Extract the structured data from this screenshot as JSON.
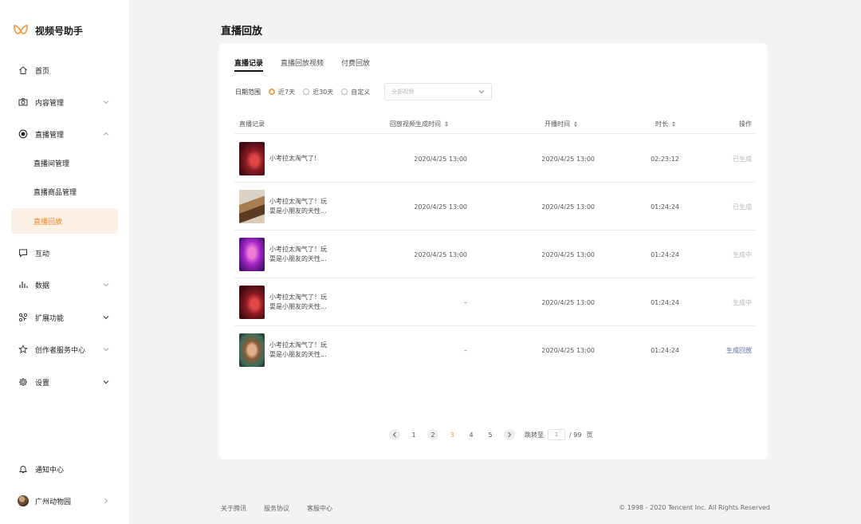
{
  "brand": {
    "name": "视频号助手",
    "accent": "#e8852a"
  },
  "sidebar": {
    "items": [
      {
        "label": "首页",
        "icon": "home-icon"
      },
      {
        "label": "内容管理",
        "icon": "camera-icon"
      },
      {
        "label": "直播管理",
        "icon": "live-icon"
      },
      {
        "label": "直播间管理"
      },
      {
        "label": "直播商品管理"
      },
      {
        "label": "直播回放",
        "active": true
      },
      {
        "label": "互动",
        "icon": "message-icon"
      },
      {
        "label": "数据",
        "icon": "bar-chart-icon"
      },
      {
        "label": "扩展功能",
        "icon": "extension-icon"
      },
      {
        "label": "创作者服务中心",
        "icon": "star-icon"
      },
      {
        "label": "设置",
        "icon": "gear-icon"
      }
    ],
    "notify": {
      "label": "通知中心",
      "icon": "bell-icon"
    },
    "account": {
      "label": "广州动物园",
      "icon": "avatar"
    }
  },
  "page": {
    "title": "直播回放"
  },
  "tabs": [
    "直播记录",
    "直播回放视频",
    "付费回放"
  ],
  "filters": {
    "label": "日期范围",
    "options": [
      "近7天",
      "近30天",
      "自定义"
    ],
    "selected": "近7天",
    "select_placeholder": "全部视频"
  },
  "table": {
    "headers": {
      "record": "直播记录",
      "gen_time": "回放视频生成时间",
      "start_time": "开播时间",
      "duration": "时长",
      "action": "操作"
    },
    "rows": [
      {
        "title1": "小考拉太淘气了!",
        "title2": "",
        "gen_time": "2020/4/25 13:00",
        "start_time": "2020/4/25 13:00",
        "duration": "02:23:12",
        "action": "已生成"
      },
      {
        "title1": "小考拉太淘气了！玩",
        "title2": "耍是小朋友的天性...",
        "gen_time": "2020/4/25 13:00",
        "start_time": "2020/4/25 13:00",
        "duration": "01:24:24",
        "action": "已生成"
      },
      {
        "title1": "小考拉太淘气了！玩",
        "title2": "耍是小朋友的天性...",
        "gen_time": "2020/4/25 13:00",
        "start_time": "2020/4/25 13:00",
        "duration": "01:24:24",
        "action": "生成中"
      },
      {
        "title1": "小考拉太淘气了！玩",
        "title2": "耍是小朋友的天性...",
        "gen_time": "–",
        "start_time": "2020/4/25 13:00",
        "duration": "01:24:24",
        "action": "生成中"
      },
      {
        "title1": "小考拉太淘气了！玩",
        "title2": "耍是小朋友的天性...",
        "gen_time": "–",
        "start_time": "2020/4/25 13:00",
        "duration": "01:24:24",
        "action": "生成回放"
      }
    ]
  },
  "pagination": {
    "pages": [
      "1",
      "2",
      "3",
      "4",
      "5"
    ],
    "current": "3",
    "jump_label": "跳转至",
    "jump_value": "1",
    "total": "/ 99",
    "unit": "页"
  },
  "footer": {
    "links": [
      "关于腾讯",
      "服务协议",
      "客服中心"
    ],
    "copyright": "© 1998 - 2020 Tencent Inc. All Rights Reserved"
  }
}
